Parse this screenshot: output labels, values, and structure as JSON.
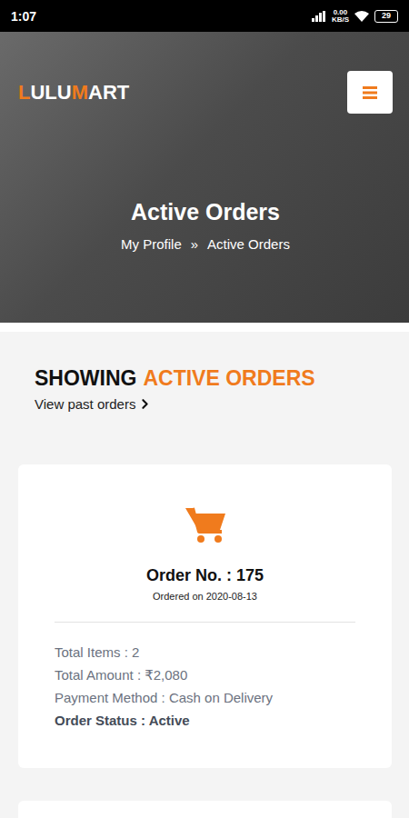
{
  "status_bar": {
    "time": "1:07",
    "network_speed": "0.00",
    "network_unit": "KB/S",
    "battery": "29"
  },
  "header": {
    "logo": [
      {
        "text": "L",
        "accent": true
      },
      {
        "text": "ULU",
        "accent": false
      },
      {
        "text": "M",
        "accent": true
      },
      {
        "text": "ART",
        "accent": false
      }
    ]
  },
  "hero": {
    "title": "Active Orders",
    "breadcrumb": [
      "My Profile",
      "Active Orders"
    ],
    "separator": "»"
  },
  "section": {
    "title": [
      {
        "text": "SHOWING",
        "accent": false
      },
      {
        "text": "ACTIVE ORDERS",
        "accent": true
      }
    ],
    "link": "View past orders"
  },
  "orders": [
    {
      "title": "Order No. : 175",
      "date": "Ordered on 2020-08-13",
      "details": [
        {
          "text": "Total Items : 2",
          "emphasis": false
        },
        {
          "text": "Total Amount : ₹2,080",
          "emphasis": false
        },
        {
          "text": "Payment Method : Cash on Delivery",
          "emphasis": false
        },
        {
          "text": "Order Status : Active",
          "emphasis": true
        }
      ]
    }
  ]
}
